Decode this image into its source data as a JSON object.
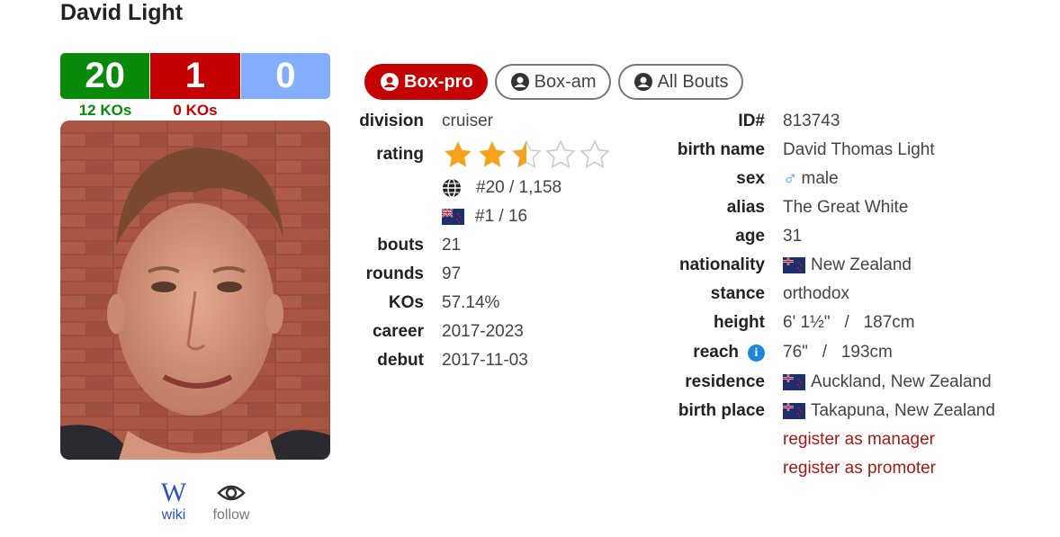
{
  "boxer": {
    "name": "David Light"
  },
  "record": {
    "wins": "20",
    "losses": "1",
    "draws": "0",
    "win_kos": "12 KOs",
    "loss_kos": "0 KOs"
  },
  "colors": {
    "win": "#0a8a0a",
    "loss": "#c40000",
    "draw": "#82aefb",
    "active_tab": "#c40000"
  },
  "links": {
    "wiki": "wiki",
    "follow": "follow"
  },
  "tabs": [
    {
      "label": "Box-pro",
      "active": true
    },
    {
      "label": "Box-am",
      "active": false
    },
    {
      "label": "All Bouts",
      "active": false
    }
  ],
  "stats": {
    "division": {
      "label": "division",
      "value": "cruiser"
    },
    "rating": {
      "label": "rating",
      "stars": 2.5,
      "max_stars": 5
    },
    "world_rank": "#20 / 1,158",
    "country_rank": "#1 / 16",
    "bouts": {
      "label": "bouts",
      "value": "21"
    },
    "rounds": {
      "label": "rounds",
      "value": "97"
    },
    "kos": {
      "label": "KOs",
      "value": "57.14%"
    },
    "career": {
      "label": "career",
      "value": "2017-2023"
    },
    "debut": {
      "label": "debut",
      "value": "2017-11-03"
    }
  },
  "bio": {
    "id": {
      "label": "ID#",
      "value": "813743"
    },
    "birth_name": {
      "label": "birth name",
      "value": "David Thomas Light"
    },
    "sex": {
      "label": "sex",
      "value": "male"
    },
    "alias": {
      "label": "alias",
      "value": "The Great White"
    },
    "age": {
      "label": "age",
      "value": "31"
    },
    "nationality": {
      "label": "nationality",
      "value": "New Zealand"
    },
    "stance": {
      "label": "stance",
      "value": "orthodox"
    },
    "height": {
      "label": "height",
      "value": "6' 1½\"   /   187cm"
    },
    "reach": {
      "label": "reach",
      "value": "76\"   /   193cm"
    },
    "residence": {
      "label": "residence",
      "value": "Auckland, New Zealand"
    },
    "birth_place": {
      "label": "birth place",
      "value": "Takapuna, New Zealand"
    },
    "register_manager": "register as manager",
    "register_promoter": "register as promoter"
  }
}
